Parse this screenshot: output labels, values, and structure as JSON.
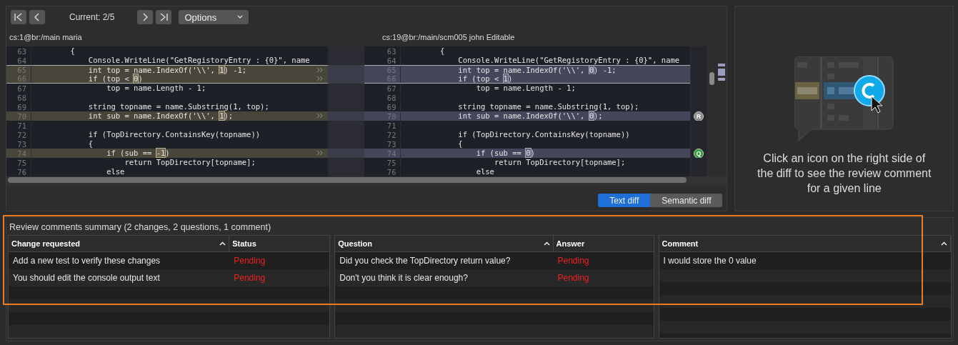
{
  "toolbar": {
    "position": "Current: 2/5",
    "options_label": "Options"
  },
  "diff": {
    "left_header": "cs:1@br:/main maria",
    "right_header": "cs:19@br:/main/scm005 john Editable",
    "lines": [
      {
        "number": "63",
        "right_number": "63",
        "changed": false,
        "current": false,
        "left": [
          {
            "t": "        {"
          }
        ],
        "right": [
          {
            "t": "        {"
          }
        ]
      },
      {
        "number": "64",
        "right_number": "64",
        "changed": false,
        "current": false,
        "left": [
          {
            "t": "            Console.WriteLine(\"GetRegistoryEntry : {0}\", name"
          }
        ],
        "right": [
          {
            "t": "            Console.WriteLine(\"GetRegistoryEntry : {0}\", name"
          }
        ]
      },
      {
        "number": "65",
        "right_number": "65",
        "changed": true,
        "current": true,
        "left": [
          {
            "t": "            int top = name.IndexOf('\\\\', "
          },
          {
            "t": "1",
            "token": true
          },
          {
            "t": ") -1;"
          }
        ],
        "right": [
          {
            "t": "            int top = name.IndexOf('\\\\', "
          },
          {
            "t": "0",
            "token": true
          },
          {
            "t": ") -1;"
          }
        ]
      },
      {
        "number": "66",
        "right_number": "66",
        "changed": true,
        "current": true,
        "left": [
          {
            "t": "            if (top < "
          },
          {
            "t": "0",
            "token": true
          },
          {
            "t": ")"
          }
        ],
        "right": [
          {
            "t": "            if (top < "
          },
          {
            "t": "1",
            "token": true
          },
          {
            "t": ")"
          }
        ]
      },
      {
        "number": "67",
        "right_number": "67",
        "changed": false,
        "current": false,
        "left": [
          {
            "t": "                top = name.Length - 1;"
          }
        ],
        "right": [
          {
            "t": "                top = name.Length - 1;"
          }
        ]
      },
      {
        "number": "68",
        "right_number": "68",
        "changed": false,
        "current": false
      },
      {
        "number": "69",
        "right_number": "69",
        "changed": false,
        "current": false,
        "left": [
          {
            "t": "            string topname = name.Substring(1, top);"
          }
        ],
        "right": [
          {
            "t": "            string topname = name.Substring(1, top);"
          }
        ]
      },
      {
        "number": "70",
        "right_number": "70",
        "changed": true,
        "current": false,
        "left": [
          {
            "t": "            int sub = name.IndexOf('\\\\', "
          },
          {
            "t": "1",
            "token": true
          },
          {
            "t": ");"
          }
        ],
        "right": [
          {
            "t": "            int sub = name.IndexOf('\\\\', "
          },
          {
            "t": "0",
            "token": true
          },
          {
            "t": ");"
          }
        ],
        "review_mark": {
          "letter": "R",
          "color": "#8c8c8c"
        }
      },
      {
        "number": "71",
        "right_number": "71",
        "changed": false,
        "current": false
      },
      {
        "number": "72",
        "right_number": "72",
        "changed": false,
        "current": false,
        "left": [
          {
            "t": "            if (TopDirectory.ContainsKey(topname))"
          }
        ],
        "right": [
          {
            "t": "            if (TopDirectory.ContainsKey(topname))"
          }
        ]
      },
      {
        "number": "73",
        "right_number": "73",
        "changed": false,
        "current": false,
        "left": [
          {
            "t": "            {"
          }
        ],
        "right": [
          {
            "t": "            {"
          }
        ]
      },
      {
        "number": "74",
        "right_number": "74",
        "changed": true,
        "current": false,
        "left": [
          {
            "t": "                if (sub == "
          },
          {
            "t": "-1",
            "token": true
          },
          {
            "t": ")"
          }
        ],
        "right": [
          {
            "t": "                if (sub == "
          },
          {
            "t": "0",
            "token": true
          },
          {
            "t": ")"
          }
        ],
        "review_mark": {
          "letter": "Q",
          "color": "#2f9e3a"
        }
      },
      {
        "number": "75",
        "right_number": "75",
        "changed": false,
        "current": false,
        "left": [
          {
            "t": "                    return TopDirectory[topname];"
          }
        ],
        "right": [
          {
            "t": "                    return TopDirectory[topname];"
          }
        ]
      },
      {
        "number": "76",
        "right_number": "76",
        "changed": false,
        "current": false,
        "left": [
          {
            "t": "                else"
          }
        ],
        "right": [
          {
            "t": "                else"
          }
        ]
      }
    ],
    "modes": [
      {
        "label": "Text diff",
        "selected": true
      },
      {
        "label": "Semantic diff",
        "selected": false
      }
    ]
  },
  "hint": {
    "text": "Click an icon on the right side of the diff to see the review comment for a given line"
  },
  "summary": {
    "title": "Review comments summary (2 changes, 2 questions, 1 comment)",
    "highlighted": true,
    "tables": [
      {
        "columns": [
          {
            "label": "Change requested",
            "sorted": true
          },
          {
            "label": "Status",
            "sorted": false
          }
        ],
        "rows": [
          [
            "Add a new test to verify these changes",
            "Pending"
          ],
          [
            "You should edit the console output text",
            "Pending"
          ]
        ]
      },
      {
        "columns": [
          {
            "label": "Question",
            "sorted": true
          },
          {
            "label": "Answer",
            "sorted": false
          }
        ],
        "rows": [
          [
            "Did you check the TopDirectory return value?",
            "Pending"
          ],
          [
            "Don't you think it is clear enough?",
            "Pending"
          ]
        ]
      },
      {
        "columns": [
          {
            "label": "Comment",
            "sorted": true
          }
        ],
        "rows": [
          [
            "I would store the 0 value"
          ]
        ]
      }
    ]
  }
}
